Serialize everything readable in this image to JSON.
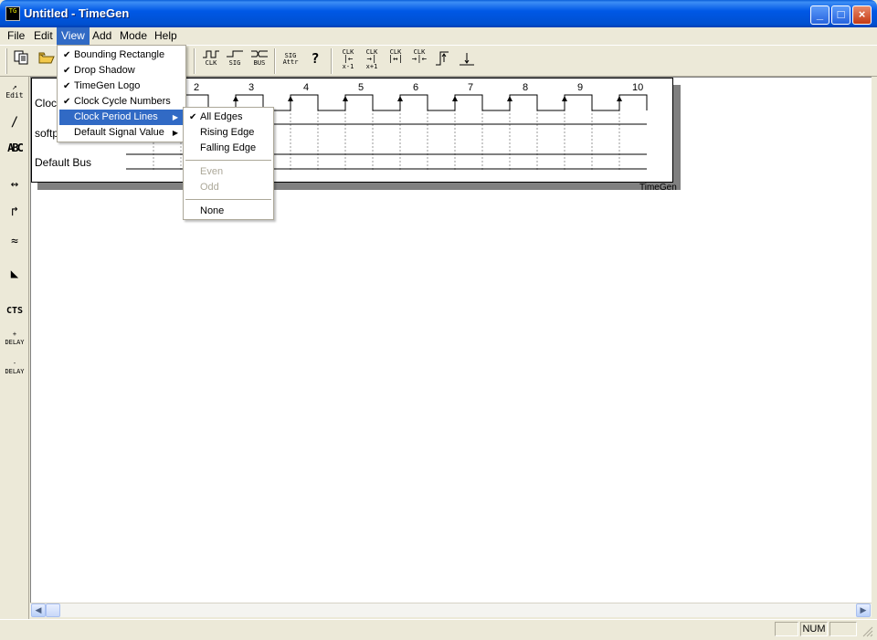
{
  "window": {
    "title": "Untitled - TimeGen",
    "app_icon_text": "TG"
  },
  "menubar": [
    "File",
    "Edit",
    "View",
    "Add",
    "Mode",
    "Help"
  ],
  "view_menu": {
    "items": [
      {
        "label": "Bounding Rectangle",
        "checked": true
      },
      {
        "label": "Drop Shadow",
        "checked": true
      },
      {
        "label": "TimeGen Logo",
        "checked": true
      },
      {
        "label": "Clock Cycle Numbers",
        "checked": true
      },
      {
        "label": "Clock Period Lines",
        "submenu": true,
        "highlighted": true
      },
      {
        "label": "Default Signal Value",
        "submenu": true
      }
    ]
  },
  "clock_period_submenu": {
    "items": [
      {
        "label": "All Edges",
        "checked": true
      },
      {
        "label": "Rising Edge"
      },
      {
        "label": "Falling Edge"
      },
      {
        "label": "Even",
        "disabled": true
      },
      {
        "label": "Odd",
        "disabled": true
      },
      {
        "label": "None"
      }
    ]
  },
  "toolbar": {
    "clk_label": "CLK",
    "sig_label": "SIG",
    "bus_label": "BUS",
    "sig_attr_label": "SIG Attr",
    "x_minus_1": "x-1",
    "x_plus_1": "x+1"
  },
  "left_tools": {
    "edit_label": "Edit",
    "abc_label": "ABC",
    "cts_label": "CTS",
    "plus_delay": "+ DELAY",
    "minus_delay": "- DELAY"
  },
  "diagram": {
    "signals": [
      "Clock",
      "softp",
      "Default Bus"
    ],
    "cycle_numbers": [
      "2",
      "3",
      "4",
      "5",
      "6",
      "7",
      "8",
      "9",
      "10"
    ],
    "logo": "TimeGen"
  },
  "statusbar": {
    "num": "NUM"
  }
}
